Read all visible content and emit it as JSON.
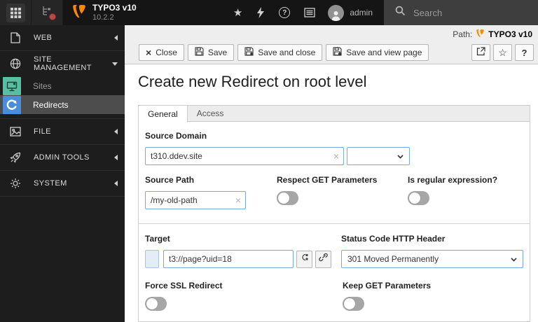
{
  "topbar": {
    "brand": "TYPO3 v10",
    "version": "10.2.2",
    "username": "admin",
    "search_placeholder": "Search"
  },
  "icons": {
    "help": "?",
    "bookmark_star": "★",
    "docheader_star": "☆",
    "docheader_help": "?",
    "close_x": "×",
    "clear_x": "×",
    "named": [
      "modules-grid-icon",
      "pagetree-toggle-icon",
      "typo3-logo",
      "bookmark-star-icon",
      "clear-cache-bolt-icon",
      "help-icon",
      "system-information-icon",
      "avatar",
      "search-icon",
      "file-icon",
      "globe-icon",
      "sites-module-icon",
      "redirects-module-icon",
      "image-icon",
      "rocket-icon",
      "gear-icon",
      "floppy-icon",
      "open-new-window-icon",
      "link-icon",
      "insert-record-icon"
    ]
  },
  "sidebar": {
    "sections": [
      {
        "label": "WEB",
        "state": "collapsed"
      },
      {
        "label": "SITE MANAGEMENT",
        "state": "expanded"
      },
      {
        "label": "FILE",
        "state": "collapsed"
      },
      {
        "label": "ADMIN TOOLS",
        "state": "collapsed"
      },
      {
        "label": "SYSTEM",
        "state": "collapsed"
      }
    ],
    "site_management_children": [
      {
        "label": "Sites",
        "active": false
      },
      {
        "label": "Redirects",
        "active": true
      }
    ]
  },
  "docheader": {
    "path_label": "Path:",
    "path_value": "TYPO3 v10",
    "buttons": {
      "close": "Close",
      "save": "Save",
      "save_close": "Save and close",
      "save_view": "Save and view page"
    }
  },
  "main": {
    "title": "Create new Redirect on root level",
    "tabs": [
      {
        "label": "General",
        "active": true
      },
      {
        "label": "Access",
        "active": false
      }
    ],
    "form": {
      "source_domain": {
        "label": "Source Domain",
        "value": "t310.ddev.site"
      },
      "source_domain_select": {
        "value": ""
      },
      "source_path": {
        "label": "Source Path",
        "value": "/my-old-path"
      },
      "respect_get": {
        "label": "Respect GET Parameters",
        "state": "off"
      },
      "is_regex": {
        "label": "Is regular expression?",
        "state": "off"
      },
      "target": {
        "label": "Target",
        "value": "t3://page?uid=18"
      },
      "status_code": {
        "label": "Status Code HTTP Header",
        "value": "301 Moved Permanently"
      },
      "force_ssl": {
        "label": "Force SSL Redirect",
        "state": "off"
      },
      "keep_get": {
        "label": "Keep GET Parameters",
        "state": "off"
      }
    }
  },
  "colors": {
    "topbar_bg": "#151515",
    "sidebar_bg": "#1d1d1d",
    "active_item_bg": "#4d4d4d",
    "sites_icon": "#5abfa2",
    "redirects_icon": "#4a8ed9",
    "typo3_orange": "#ff8700",
    "input_focus_border": "#79a9dd",
    "docheader_bg": "#eeeeee"
  }
}
